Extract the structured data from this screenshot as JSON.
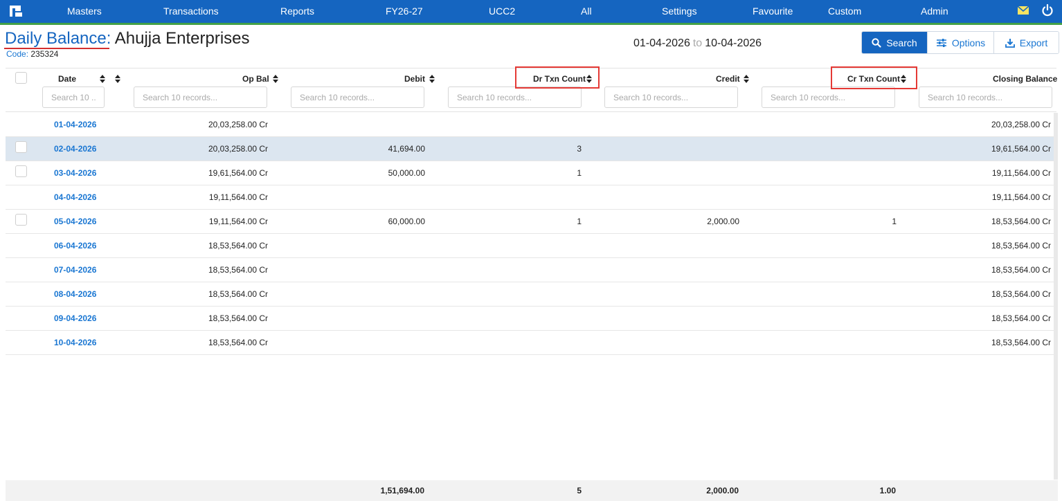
{
  "nav": {
    "items": [
      "Masters",
      "Transactions",
      "Reports",
      "FY26-27",
      "UCC2",
      "All",
      "Settings",
      "Favourite",
      "Custom",
      "Admin"
    ]
  },
  "header": {
    "title_link": "Daily Balance",
    "title_sep": ":",
    "title_name": "Ahujja Enterprises",
    "code_label": "Code:",
    "code_value": "235324",
    "date_from": "01-04-2026",
    "date_to_word": "to",
    "date_to": "10-04-2026"
  },
  "toolbar": {
    "search_label": "Search",
    "options_label": "Options",
    "export_label": "Export"
  },
  "table": {
    "columns": {
      "date": "Date",
      "op_bal": "Op Bal",
      "debit": "Debit",
      "dr_txn_count": "Dr Txn Count",
      "credit": "Credit",
      "cr_txn_count": "Cr Txn Count",
      "closing_balance": "Closing Balance"
    },
    "search_placeholder_short": "Search 10 ...",
    "search_placeholder": "Search 10 records...",
    "rows": [
      {
        "date": "01-04-2026",
        "op_bal": "20,03,258.00 Cr",
        "debit": "",
        "dr_count": "",
        "credit": "",
        "cr_count": "",
        "closing": "20,03,258.00 Cr",
        "checkbox": false,
        "selected": false
      },
      {
        "date": "02-04-2026",
        "op_bal": "20,03,258.00 Cr",
        "debit": "41,694.00",
        "dr_count": "3",
        "credit": "",
        "cr_count": "",
        "closing": "19,61,564.00 Cr",
        "checkbox": true,
        "selected": true
      },
      {
        "date": "03-04-2026",
        "op_bal": "19,61,564.00 Cr",
        "debit": "50,000.00",
        "dr_count": "1",
        "credit": "",
        "cr_count": "",
        "closing": "19,11,564.00 Cr",
        "checkbox": true,
        "selected": false
      },
      {
        "date": "04-04-2026",
        "op_bal": "19,11,564.00 Cr",
        "debit": "",
        "dr_count": "",
        "credit": "",
        "cr_count": "",
        "closing": "19,11,564.00 Cr",
        "checkbox": false,
        "selected": false
      },
      {
        "date": "05-04-2026",
        "op_bal": "19,11,564.00 Cr",
        "debit": "60,000.00",
        "dr_count": "1",
        "credit": "2,000.00",
        "cr_count": "1",
        "closing": "18,53,564.00 Cr",
        "checkbox": true,
        "selected": false
      },
      {
        "date": "06-04-2026",
        "op_bal": "18,53,564.00 Cr",
        "debit": "",
        "dr_count": "",
        "credit": "",
        "cr_count": "",
        "closing": "18,53,564.00 Cr",
        "checkbox": false,
        "selected": false
      },
      {
        "date": "07-04-2026",
        "op_bal": "18,53,564.00 Cr",
        "debit": "",
        "dr_count": "",
        "credit": "",
        "cr_count": "",
        "closing": "18,53,564.00 Cr",
        "checkbox": false,
        "selected": false
      },
      {
        "date": "08-04-2026",
        "op_bal": "18,53,564.00 Cr",
        "debit": "",
        "dr_count": "",
        "credit": "",
        "cr_count": "",
        "closing": "18,53,564.00 Cr",
        "checkbox": false,
        "selected": false
      },
      {
        "date": "09-04-2026",
        "op_bal": "18,53,564.00 Cr",
        "debit": "",
        "dr_count": "",
        "credit": "",
        "cr_count": "",
        "closing": "18,53,564.00 Cr",
        "checkbox": false,
        "selected": false
      },
      {
        "date": "10-04-2026",
        "op_bal": "18,53,564.00 Cr",
        "debit": "",
        "dr_count": "",
        "credit": "",
        "cr_count": "",
        "closing": "18,53,564.00 Cr",
        "checkbox": false,
        "selected": false
      }
    ],
    "totals": {
      "debit": "1,51,694.00",
      "dr_count": "5",
      "credit": "2,000.00",
      "cr_count": "1.00"
    }
  },
  "colors": {
    "nav_bg": "#1565c0",
    "nav_accent": "#43a047",
    "link": "#1976d2",
    "highlight": "#e53935",
    "selected_row": "#dce6f0"
  },
  "icons": {
    "logo": "app-logo-icon",
    "mail": "mail-icon",
    "power": "power-icon",
    "search": "search-icon",
    "options": "sliders-icon",
    "export": "download-icon",
    "sort": "sort-icon"
  }
}
